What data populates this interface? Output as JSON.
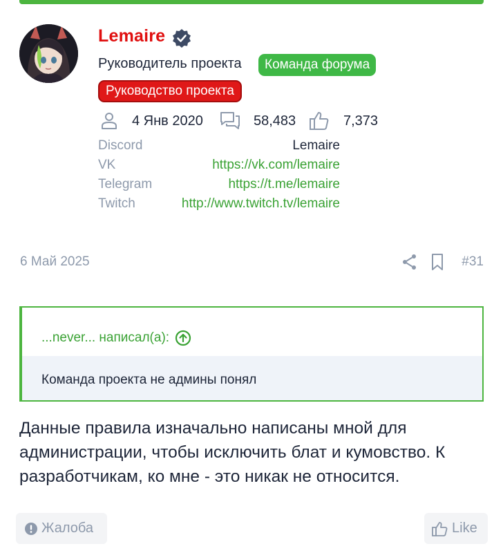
{
  "colors": {
    "accent_green": "#4cb53f",
    "username_red": "#e00f0f",
    "muted": "#8d99ab",
    "text": "#1d2538",
    "link_green": "#3aa234"
  },
  "user": {
    "name": "Lemaire",
    "title": "Руководитель проекта",
    "badges": [
      {
        "label": "Команда форума",
        "color": "#3fb846"
      },
      {
        "label": "Руководство проекта",
        "color": "#e01818"
      }
    ],
    "stats": {
      "joined": "4 Янв 2020",
      "messages": "58,483",
      "reactions": "7,373"
    },
    "contacts": [
      {
        "key": "Discord",
        "value": "Lemaire"
      },
      {
        "key": "VK",
        "value": "https://vk.com/lemaire"
      },
      {
        "key": "Telegram",
        "value": "https://t.me/lemaire"
      },
      {
        "key": "Twitch",
        "value": "http://www.twitch.tv/lemaire"
      }
    ]
  },
  "post": {
    "date": "6 Май 2025",
    "number": "#31",
    "quote": {
      "author_line": "...never... написал(а):",
      "text": "Команда проекта не админы понял"
    },
    "body": "Данные правила изначально написаны мной для администрации, чтобы исключить блат и кумовство. К разработчикам, ко мне - это никак не относится."
  },
  "actions": {
    "report_label": "Жалоба",
    "like_label": "Like"
  }
}
